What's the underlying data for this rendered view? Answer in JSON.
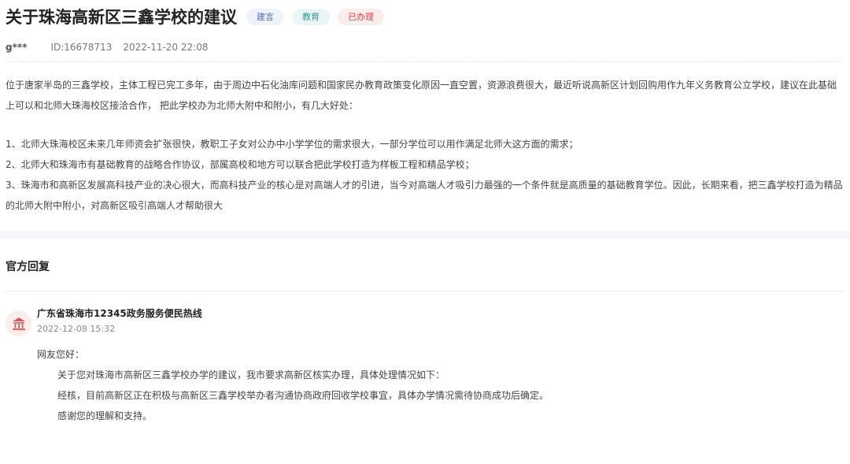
{
  "header": {
    "title": "关于珠海高新区三鑫学校的建议",
    "tags": [
      {
        "label": "建言"
      },
      {
        "label": "教育"
      },
      {
        "label": "已办理"
      }
    ],
    "user": "g***",
    "id_text": "ID:16678713",
    "datetime": "2022-11-20 22:08"
  },
  "content": {
    "intro": "位于唐家半岛的三鑫学校，主体工程已完工多年，由于周边中石化油库问题和国家民办教育政策变化原因一直空置，资源浪费很大，最近听说高新区计划回购用作九年义务教育公立学校，建议在此基础上可以和北师大珠海校区接洽合作， 把此学校办为北师大附中和附小，有几大好处：",
    "points": [
      "1、北师大珠海校区未来几年师资会扩张很快，教职工子女对公办中小学学位的需求很大，一部分学位可以用作满足北师大这方面的需求；",
      "2、北师大和珠海市有基础教育的战略合作协议，部属高校和地方可以联合把此学校打造为样板工程和精品学校；",
      "3、珠海市和高新区发展高科技产业的决心很大，而高科技产业的核心是对高端人才的引进，当今对高端人才吸引力最强的一个条件就是高质量的基础教育学位。因此，长期来看，把三鑫学校打造为精品的北师大附中附小，对高新区吸引高端人才帮助很大"
    ]
  },
  "reply": {
    "section_title": "官方回复",
    "org_icon": "government-building-icon",
    "org_name": "广东省珠海市12345政务服务便民热线",
    "date": "2022-12-08 15:32",
    "greeting": "网友您好：",
    "lines": [
      "关于您对珠海市高新区三鑫学校办学的建议，我市要求高新区核实办理，具体处理情况如下：",
      "经核，目前高新区正在积极与高新区三鑫学校举办者沟通协商政府回收学校事宜，具体办学情况需待协商成功后确定。",
      "感谢您的理解和支持。"
    ]
  },
  "colors": {
    "tag_blue": "#4a6fbf",
    "tag_teal": "#2e9c9c",
    "tag_red": "#e04848",
    "icon_red": "#e05555"
  }
}
